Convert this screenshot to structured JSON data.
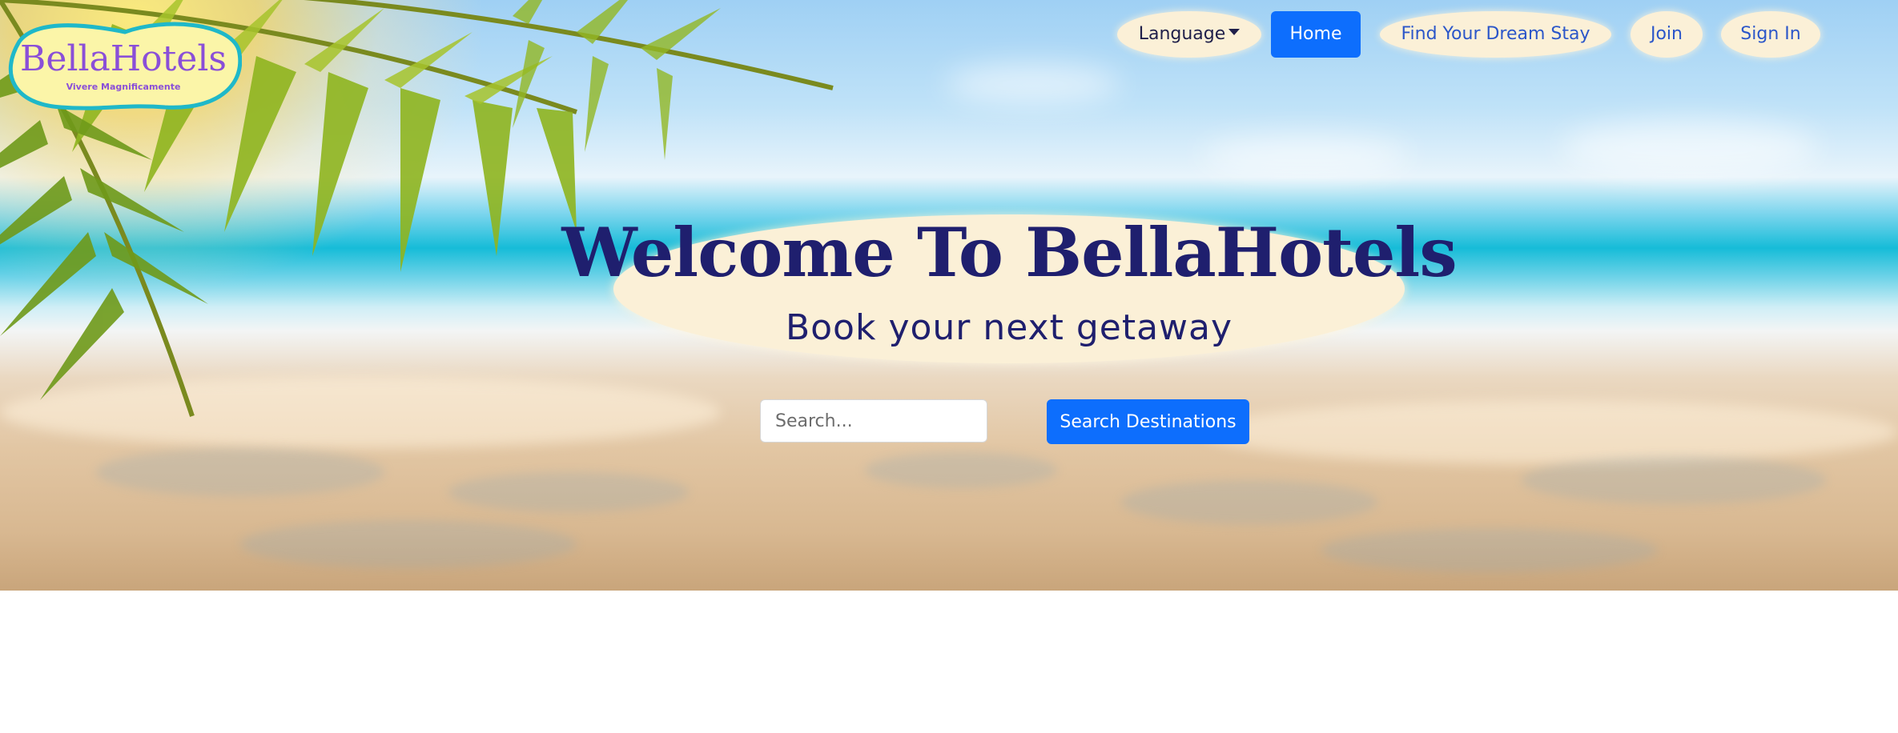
{
  "brand": {
    "name": "BellaHotels",
    "tagline": "Vivere Magnificamente"
  },
  "nav": {
    "language_label": "Language",
    "home_label": "Home",
    "find_label": "Find Your Dream Stay",
    "join_label": "Join",
    "signin_label": "Sign In"
  },
  "hero": {
    "title": "Welcome To BellaHotels",
    "subtitle": "Book your next getaway"
  },
  "search": {
    "placeholder": "Search...",
    "button_label": "Search Destinations"
  },
  "colors": {
    "primary": "#0d6efd",
    "heading": "#1f1f6e",
    "pill_bg": "#fbf0d7",
    "logo_text": "#8a4fd8",
    "logo_border": "#1fb8c9"
  },
  "icons": {
    "language_caret": "caret-down-icon"
  }
}
